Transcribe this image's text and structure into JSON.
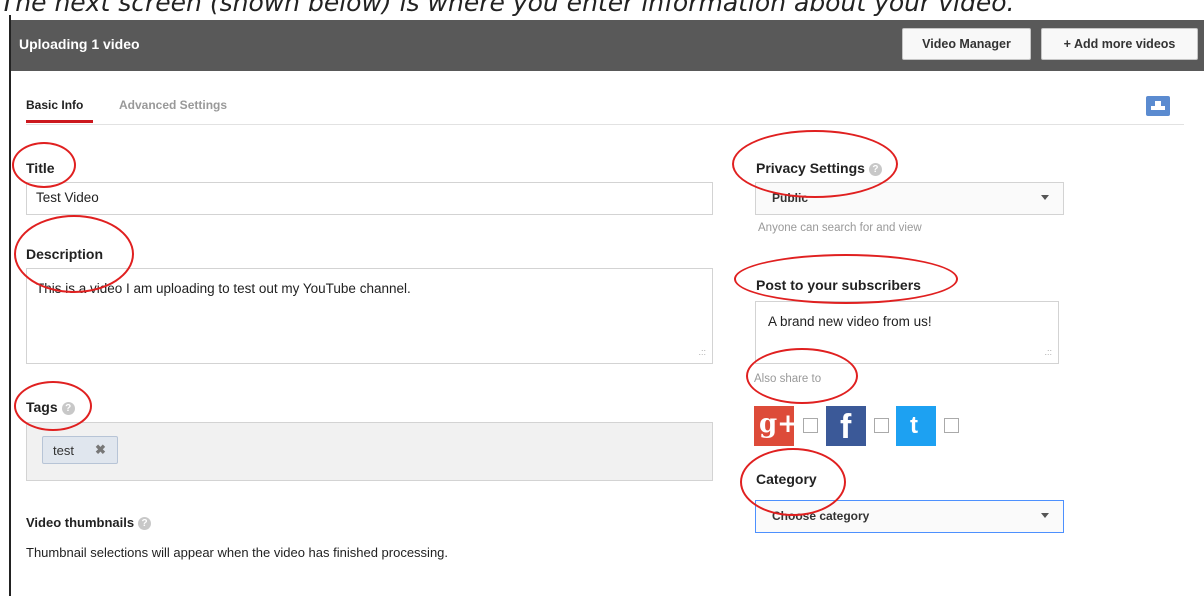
{
  "caption": "The next screen (shown below) is where you enter information about your video.",
  "header": {
    "title": "Uploading 1 video",
    "video_manager_label": "Video Manager",
    "add_more_label": "+ Add more videos"
  },
  "tabs": [
    {
      "label": "Basic Info",
      "active": true
    },
    {
      "label": "Advanced Settings",
      "active": false
    }
  ],
  "form": {
    "title_label": "Title",
    "title_value": "Test Video",
    "description_label": "Description",
    "description_value": "This is a video I am uploading to test out my YouTube channel.",
    "tags_label": "Tags",
    "tags": [
      {
        "label": "test",
        "remove_icon": "x-icon"
      }
    ],
    "thumbnails_label": "Video thumbnails",
    "thumbnails_text": "Thumbnail selections will appear when the video has finished processing."
  },
  "privacy": {
    "label": "Privacy Settings",
    "value": "Public",
    "hint": "Anyone can search for and view"
  },
  "subscribers": {
    "label": "Post to your subscribers",
    "value": "A brand new video from us!",
    "share_label": "Also share to"
  },
  "social": [
    {
      "name": "google-plus",
      "glyph": "g+",
      "color": "#dd4b39"
    },
    {
      "name": "facebook",
      "glyph": "f",
      "color": "#3b5998"
    },
    {
      "name": "twitter",
      "glyph": "t",
      "color": "#1da1f2"
    }
  ],
  "category": {
    "label": "Category",
    "value": "Choose category"
  },
  "colors": {
    "header_bg": "#595959",
    "tab_accent": "#cc181e",
    "annotation": "#e02020"
  }
}
